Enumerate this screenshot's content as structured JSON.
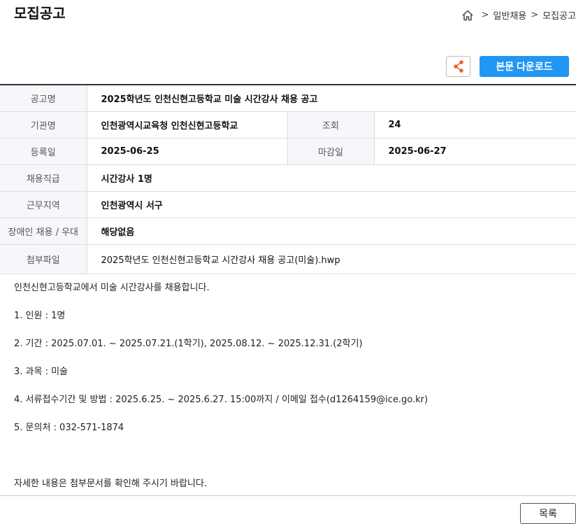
{
  "page": {
    "title": "모집공고"
  },
  "breadcrumb": {
    "sep": ">",
    "level1": "일반채용",
    "level2": "모집공고"
  },
  "actions": {
    "download_label": "본문 다운로드",
    "list_label": "목록"
  },
  "info": {
    "title_label": "공고명",
    "title_value": "2025학년도 인천신현고등학교 미술 시간강사 채용 공고",
    "org_label": "기관명",
    "org_value": "인천광역시교육청 인천신현고등학교",
    "views_label": "조회",
    "views_value": "24",
    "reg_label": "등록일",
    "reg_value": "2025-06-25",
    "deadline_label": "마감일",
    "deadline_value": "2025-06-27",
    "position_label": "채용직급",
    "position_value": "시간강사 1명",
    "region_label": "근무지역",
    "region_value": "인천광역시 서구",
    "disabled_label": "장애인 채용 / 우대",
    "disabled_value": "해당없음",
    "attach_label": "첨부파일",
    "attach_value": "2025학년도 인천신현고등학교 시간강사 채용 공고(미술).hwp"
  },
  "content": {
    "intro": "인천신현고등학교에서 미술 시간강사를 채용합니다.",
    "item1": "1. 인원 : 1명",
    "item2": "2. 기간 : 2025.07.01. ~ 2025.07.21.(1학기), 2025.08.12. ~ 2025.12.31.(2학기)",
    "item3": "3. 과목 : 미술",
    "item4": "4. 서류접수기간 및 방법 : 2025.6.25. ~ 2025.6.27. 15:00까지 / 이메일 접수(d1264159@ice.go.kr)",
    "item5": "5. 문의처 : 032-571-1874",
    "outro": "자세한 내용은 첨부문서를 확인해 주시기 바랍니다."
  },
  "colors": {
    "accent": "#2196f3",
    "share_icon": "#e8642c"
  },
  "icons": {
    "home": "home-icon",
    "share": "share-icon"
  }
}
